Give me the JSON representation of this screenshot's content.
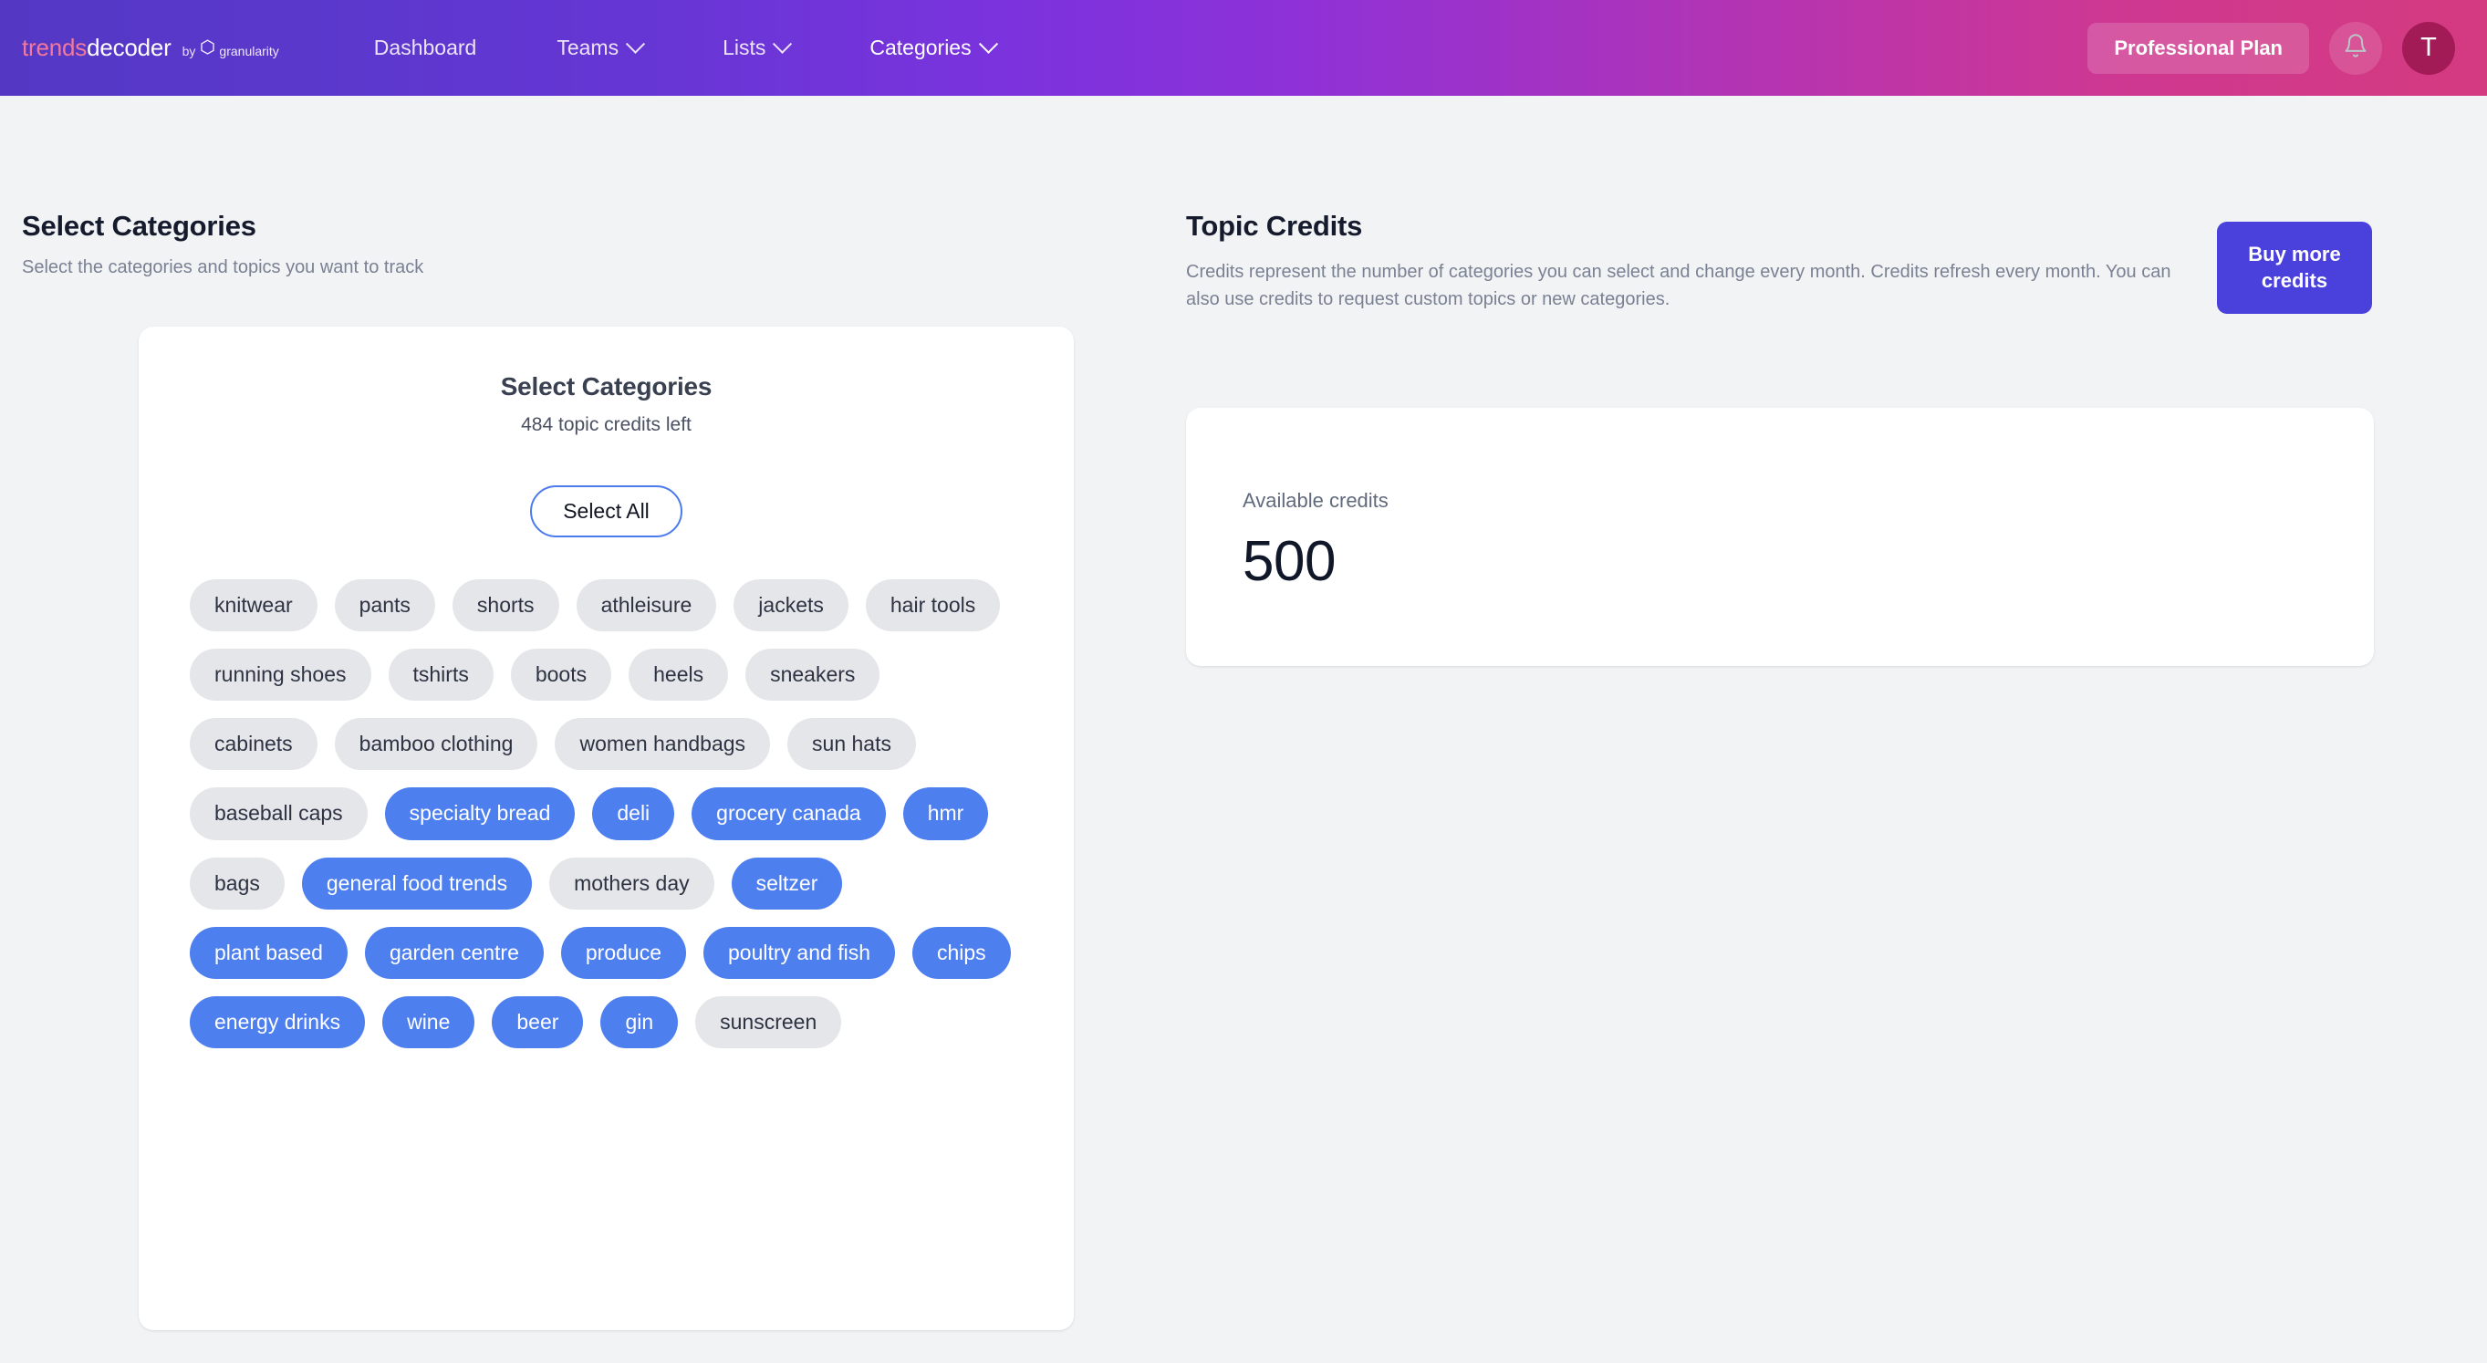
{
  "navbar": {
    "brand": {
      "trends": "trends",
      "decoder": "decoder",
      "by": "by",
      "company": "granularity",
      "hex_icon": "hexagon-icon"
    },
    "links": [
      {
        "label": "Dashboard",
        "has_chevron": false,
        "active": false
      },
      {
        "label": "Teams",
        "has_chevron": true,
        "active": false
      },
      {
        "label": "Lists",
        "has_chevron": true,
        "active": false
      },
      {
        "label": "Categories",
        "has_chevron": true,
        "active": true
      }
    ],
    "plan_badge": "Professional Plan",
    "notifications_icon": "bell-icon",
    "avatar_initial": "T"
  },
  "page": {
    "title": "Select Categories",
    "subtitle": "Select the categories and topics you want to track"
  },
  "categories_card": {
    "title": "Select Categories",
    "credits_left_text": "484 topic credits left",
    "credits_left_value": 484,
    "select_all_label": "Select All",
    "chips": [
      {
        "label": "knitwear",
        "selected": false
      },
      {
        "label": "pants",
        "selected": false
      },
      {
        "label": "shorts",
        "selected": false
      },
      {
        "label": "athleisure",
        "selected": false
      },
      {
        "label": "jackets",
        "selected": false
      },
      {
        "label": "hair tools",
        "selected": false
      },
      {
        "label": "running shoes",
        "selected": false
      },
      {
        "label": "tshirts",
        "selected": false
      },
      {
        "label": "boots",
        "selected": false
      },
      {
        "label": "heels",
        "selected": false
      },
      {
        "label": "sneakers",
        "selected": false
      },
      {
        "label": "cabinets",
        "selected": false
      },
      {
        "label": "bamboo clothing",
        "selected": false
      },
      {
        "label": "women handbags",
        "selected": false
      },
      {
        "label": "sun hats",
        "selected": false
      },
      {
        "label": "baseball caps",
        "selected": false
      },
      {
        "label": "specialty bread",
        "selected": true
      },
      {
        "label": "deli",
        "selected": true
      },
      {
        "label": "grocery canada",
        "selected": true
      },
      {
        "label": "hmr",
        "selected": true
      },
      {
        "label": "bags",
        "selected": false
      },
      {
        "label": "general food trends",
        "selected": true
      },
      {
        "label": "mothers day",
        "selected": false
      },
      {
        "label": "seltzer",
        "selected": true
      },
      {
        "label": "plant based",
        "selected": true
      },
      {
        "label": "garden centre",
        "selected": true
      },
      {
        "label": "produce",
        "selected": true
      },
      {
        "label": "poultry and fish",
        "selected": true
      },
      {
        "label": "chips",
        "selected": true
      },
      {
        "label": "energy drinks",
        "selected": true
      },
      {
        "label": "wine",
        "selected": true
      },
      {
        "label": "beer",
        "selected": true
      },
      {
        "label": "gin",
        "selected": true
      },
      {
        "label": "sunscreen",
        "selected": false
      }
    ]
  },
  "topic_credits": {
    "title": "Topic Credits",
    "description": "Credits represent the number of categories you can select and change every month. Credits refresh every month. You can also use credits to request custom topics or new categories.",
    "buy_button": "Buy more credits",
    "available_label": "Available credits",
    "available_value": "500"
  },
  "colors": {
    "nav_gradient_start": "#5438C4",
    "nav_gradient_end": "#D43A80",
    "chip_selected": "#4D7FEF",
    "chip_unselected": "#E5E6E9",
    "buy_button": "#4A40DC",
    "select_all_border": "#4B7BEC",
    "page_background": "#F1F3F5",
    "avatar_background": "#A31B56"
  }
}
